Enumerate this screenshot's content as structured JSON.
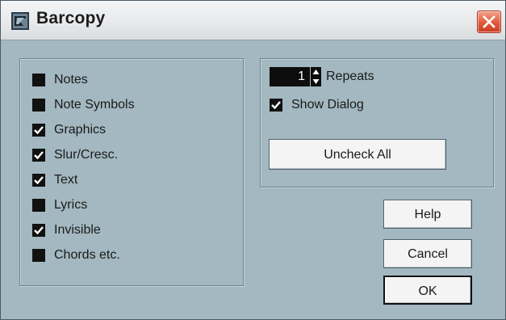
{
  "window": {
    "title": "Barcopy",
    "close_icon": "close-x-icon",
    "app_icon": "barcopy-app-icon"
  },
  "options": [
    {
      "label": "Notes",
      "checked": false
    },
    {
      "label": "Note Symbols",
      "checked": false
    },
    {
      "label": "Graphics",
      "checked": true
    },
    {
      "label": "Slur/Cresc.",
      "checked": true
    },
    {
      "label": "Text",
      "checked": true
    },
    {
      "label": "Lyrics",
      "checked": false
    },
    {
      "label": "Invisible",
      "checked": true
    },
    {
      "label": "Chords etc.",
      "checked": false
    }
  ],
  "repeats": {
    "value": "1",
    "label": "Repeats"
  },
  "show_dialog": {
    "label": "Show Dialog",
    "checked": true
  },
  "buttons": {
    "uncheck_all": "Uncheck All",
    "help": "Help",
    "cancel": "Cancel",
    "ok": "OK"
  },
  "colors": {
    "background": "#a3b8c0",
    "checkbox": "#111111",
    "close": "#e2573a"
  }
}
